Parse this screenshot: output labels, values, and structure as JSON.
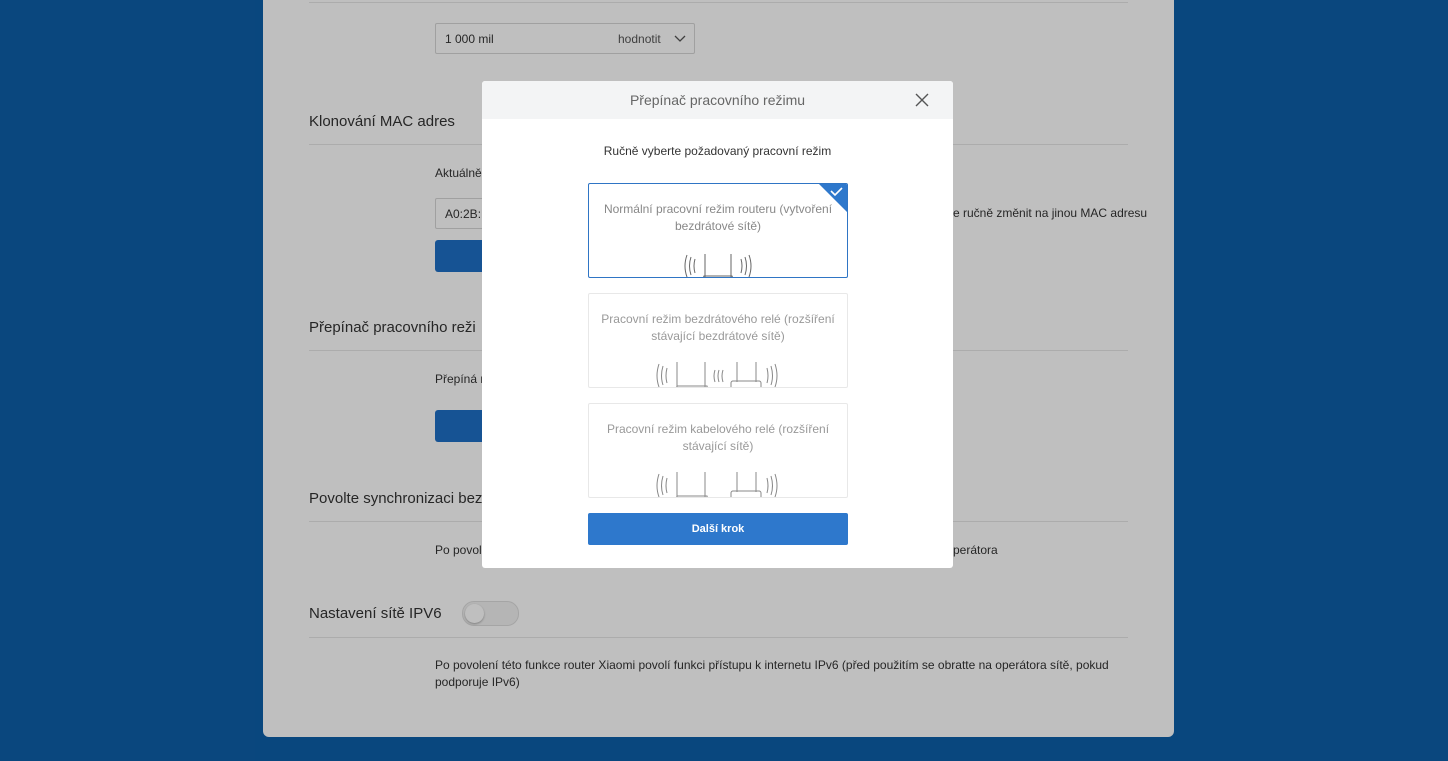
{
  "background_page": {
    "speed_select": {
      "value": "1 000 mil",
      "unit": "hodnotit"
    },
    "mac_clone": {
      "title": "Klonování MAC adres",
      "current_label": "Aktuálně",
      "mac_value": "A0:2B:B",
      "hint": "e ručně změnit na jinou MAC adresu"
    },
    "mode_switch": {
      "title": "Přepínač pracovního reži",
      "desc": "Přepíná r"
    },
    "sync": {
      "title": "Povolte synchronizaci bez",
      "desc_left": "Po povol",
      "desc_right": "perátora"
    },
    "ipv6": {
      "title": "Nastavení sítě IPV6",
      "enabled": false,
      "desc": "Po povolení této funkce router Xiaomi povolí funkci přístupu k internetu IPv6 (před použitím se obratte na operátora sítě, pokud podporuje IPv6)"
    }
  },
  "modal": {
    "title": "Přepínač pracovního režimu",
    "subtitle": "Ručně vyberte požadovaný pracovní režim",
    "options": [
      {
        "label": "Normální pracovní režim routeru (vytvoření bezdrátové sítě)",
        "selected": true,
        "icon": "single-router-icon"
      },
      {
        "label": "Pracovní režim bezdrátového relé (rozšíření stávající bezdrátové sítě)",
        "selected": false,
        "icon": "wireless-relay-icon"
      },
      {
        "label": "Pracovní režim kabelového relé (rozšíření stávající sítě)",
        "selected": false,
        "icon": "wired-relay-icon"
      }
    ],
    "next_button": "Další krok"
  },
  "colors": {
    "accent": "#2e78cc",
    "page_bg": "#0d5fa8"
  }
}
